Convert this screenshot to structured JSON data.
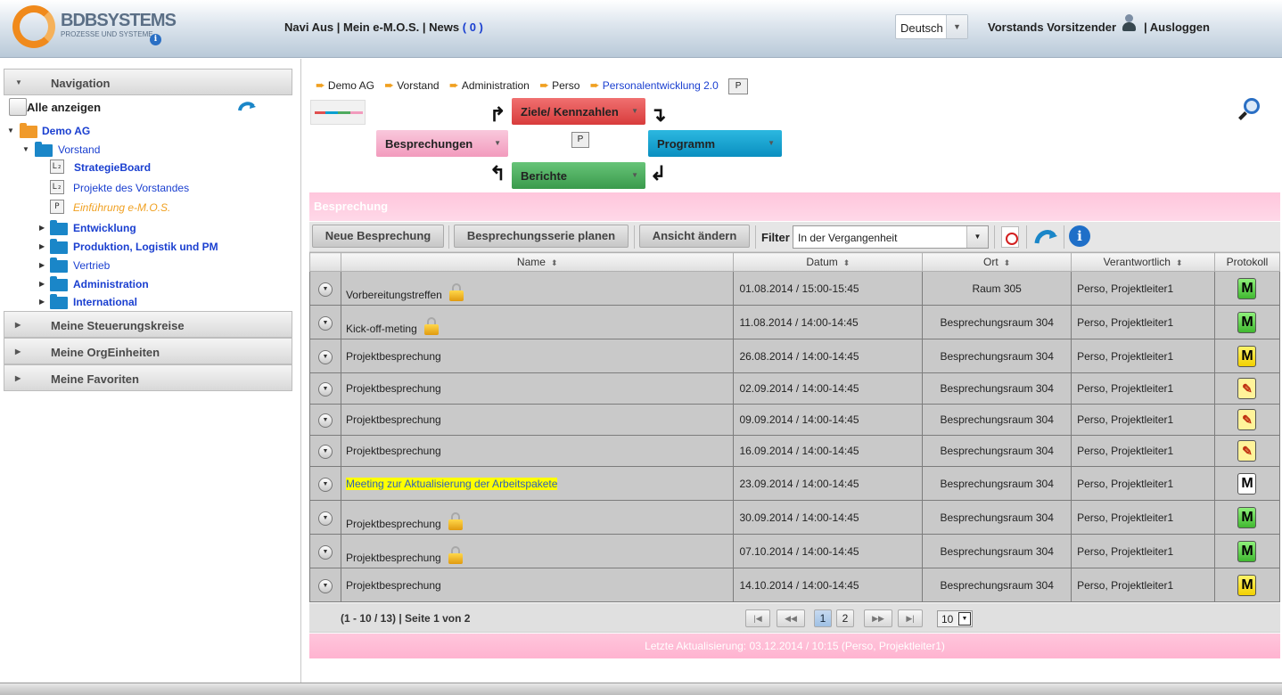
{
  "header": {
    "logo_text": "BDBSYSTEMS",
    "logo_sub": "PROZESSE UND SYSTEME",
    "nav_aus": "Navi Aus",
    "sep": "|",
    "mein_emos": "Mein e-M.O.S.",
    "news": "News",
    "news_count": "( 0 )",
    "language": "Deutsch",
    "user_name": "Vorstands Vorsitzender",
    "logout": "| Ausloggen"
  },
  "sidebar": {
    "navigation": "Navigation",
    "show_all": "Alle anzeigen",
    "tree": {
      "demo_ag": "Demo AG",
      "vorstand": "Vorstand",
      "strategieboard": "StrategieBoard",
      "projekte": "Projekte des Vorstandes",
      "einfuehrung": "Einführung e-M.O.S.",
      "entwicklung": "Entwicklung",
      "produktion": "Produktion, Logistik und PM",
      "vertrieb": "Vertrieb",
      "administration": "Administration",
      "international": "International",
      "l2": "L₂",
      "p": "P"
    },
    "sections": {
      "steuerungskreise": "Meine Steuerungskreise",
      "orgeinheiten": "Meine OrgEinheiten",
      "favoriten": "Meine Favoriten"
    }
  },
  "breadcrumb": [
    "Demo AG",
    "Vorstand",
    "Administration",
    "Perso",
    "Personalentwicklung 2.0"
  ],
  "breadcrumb_badge": "P",
  "flow": {
    "ziele": "Ziele/ Kennzahlen",
    "besprechungen": "Besprechungen",
    "programm": "Programm",
    "berichte": "Berichte",
    "center_badge": "P"
  },
  "panel": {
    "title": "Besprechung",
    "btn_new": "Neue Besprechung",
    "btn_series": "Besprechungsserie planen",
    "btn_view": "Ansicht ändern",
    "filter_label": "Filter",
    "filter_value": "In der Vergangenheit"
  },
  "table": {
    "columns": [
      "Name",
      "Datum",
      "Ort",
      "Verantwortlich",
      "Protokoll"
    ],
    "rows": [
      {
        "name": "Vorbereitungstreffen",
        "date": "01.08.2014 / 15:00-15:45",
        "ort": "Raum 305",
        "resp": "Perso, Projektleiter1",
        "prot": "M",
        "prot_type": "green",
        "locked": true,
        "highlight": false
      },
      {
        "name": "Kick-off-meting",
        "date": "11.08.2014 / 14:00-14:45",
        "ort": "Besprechungsraum 304",
        "resp": "Perso, Projektleiter1",
        "prot": "M",
        "prot_type": "green",
        "locked": true,
        "highlight": false
      },
      {
        "name": "Projektbesprechung",
        "date": "26.08.2014 / 14:00-14:45",
        "ort": "Besprechungsraum 304",
        "resp": "Perso, Projektleiter1",
        "prot": "M",
        "prot_type": "yellow",
        "locked": false,
        "highlight": false
      },
      {
        "name": "Projektbesprechung",
        "date": "02.09.2014 / 14:00-14:45",
        "ort": "Besprechungsraum 304",
        "resp": "Perso, Projektleiter1",
        "prot": "✎",
        "prot_type": "edit",
        "locked": false,
        "highlight": false
      },
      {
        "name": "Projektbesprechung",
        "date": "09.09.2014 / 14:00-14:45",
        "ort": "Besprechungsraum 304",
        "resp": "Perso, Projektleiter1",
        "prot": "✎",
        "prot_type": "edit",
        "locked": false,
        "highlight": false
      },
      {
        "name": "Projektbesprechung",
        "date": "16.09.2014 / 14:00-14:45",
        "ort": "Besprechungsraum 304",
        "resp": "Perso, Projektleiter1",
        "prot": "✎",
        "prot_type": "edit",
        "locked": false,
        "highlight": false
      },
      {
        "name": "Meeting zur Aktualisierung der Arbeitspakete",
        "date": "23.09.2014 / 14:00-14:45",
        "ort": "Besprechungsraum 304",
        "resp": "Perso, Projektleiter1",
        "prot": "M",
        "prot_type": "white",
        "locked": false,
        "highlight": true
      },
      {
        "name": "Projektbesprechung",
        "date": "30.09.2014 / 14:00-14:45",
        "ort": "Besprechungsraum 304",
        "resp": "Perso, Projektleiter1",
        "prot": "M",
        "prot_type": "green",
        "locked": true,
        "highlight": false
      },
      {
        "name": "Projektbesprechung",
        "date": "07.10.2014 / 14:00-14:45",
        "ort": "Besprechungsraum 304",
        "resp": "Perso, Projektleiter1",
        "prot": "M",
        "prot_type": "green",
        "locked": true,
        "highlight": false
      },
      {
        "name": "Projektbesprechung",
        "date": "14.10.2014 / 14:00-14:45",
        "ort": "Besprechungsraum 304",
        "resp": "Perso, Projektleiter1",
        "prot": "M",
        "prot_type": "yellow",
        "locked": false,
        "highlight": false
      }
    ]
  },
  "pager": {
    "info": "(1 - 10 / 13) | Seite 1 von 2",
    "pages": [
      "1",
      "2"
    ],
    "page_size": "10"
  },
  "footer": "Letzte Aktualisierung: 03.12.2014 / 10:15 (Perso, Projektleiter1)",
  "colors": {
    "accent_pink": "#ffc6dc",
    "link_blue": "#2f5fb8",
    "ziele_red": "#e05050",
    "programm_blue": "#0a9fd0",
    "berichte_green": "#4faa5f"
  }
}
